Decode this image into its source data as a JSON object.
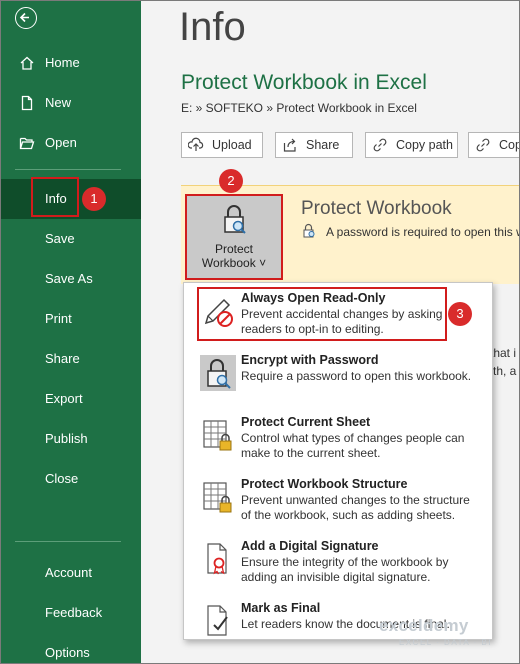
{
  "sidebar": {
    "back_icon": "back-arrow-icon",
    "items": [
      {
        "label": "Home",
        "icon": "home-icon"
      },
      {
        "label": "New",
        "icon": "new-document-icon"
      },
      {
        "label": "Open",
        "icon": "folder-open-icon"
      },
      {
        "label": "Info"
      },
      {
        "label": "Save"
      },
      {
        "label": "Save As"
      },
      {
        "label": "Print"
      },
      {
        "label": "Share"
      },
      {
        "label": "Export"
      },
      {
        "label": "Publish"
      },
      {
        "label": "Close"
      }
    ],
    "bottom_items": [
      {
        "label": "Account"
      },
      {
        "label": "Feedback"
      },
      {
        "label": "Options"
      }
    ],
    "selected": "Info"
  },
  "main": {
    "title": "Info",
    "doc_name": "Protect Workbook in Excel",
    "path": "E: » SOFTEKO » Protect Workbook in Excel",
    "toolbar": [
      {
        "label": "Upload",
        "icon": "upload-icon"
      },
      {
        "label": "Share",
        "icon": "share-icon"
      },
      {
        "label": "Copy path",
        "icon": "link-icon"
      },
      {
        "label": "Copy",
        "icon": "link-icon"
      }
    ],
    "protect": {
      "tile_line1": "Protect",
      "tile_line2": "Workbook",
      "heading": "Protect Workbook",
      "description": "A password is required to open this work"
    },
    "bg_fragments": [
      "that i",
      "th, a"
    ]
  },
  "dropdown": {
    "items": [
      {
        "title": "Always Open Read-Only",
        "desc1": "Prevent accidental changes by asking",
        "desc2": "readers to opt-in to editing.",
        "icon": "pencil-no-edit-icon"
      },
      {
        "title": "Encrypt with Password",
        "desc1": "Require a password to open this workbook.",
        "desc2": "",
        "icon": "lock-search-icon"
      },
      {
        "title": "Protect Current Sheet",
        "desc1": "Control what types of changes people can",
        "desc2": "make to the current sheet.",
        "icon": "sheet-lock-icon"
      },
      {
        "title": "Protect Workbook Structure",
        "desc1": "Prevent unwanted changes to the structure",
        "desc2": "of the workbook, such as adding sheets.",
        "icon": "workbook-lock-icon"
      },
      {
        "title": "Add a Digital Signature",
        "desc1": "Ensure the integrity of the workbook by",
        "desc2": "adding an invisible digital signature.",
        "icon": "signature-ribbon-icon"
      },
      {
        "title": "Mark as Final",
        "desc1": "Let readers know the document is final.",
        "desc2": "",
        "icon": "document-final-icon"
      }
    ]
  },
  "annotations": {
    "badge1": "1",
    "badge2": "2",
    "badge3": "3"
  },
  "watermark": {
    "line1": "exceldemy",
    "line2": "EXCEL · DATA · BI"
  },
  "colors": {
    "sidebar": "#1e7145",
    "selected": "#0f4d2a",
    "accent": "#1e7145",
    "annotation": "#d92b2b",
    "panel": "#fff2cc"
  }
}
